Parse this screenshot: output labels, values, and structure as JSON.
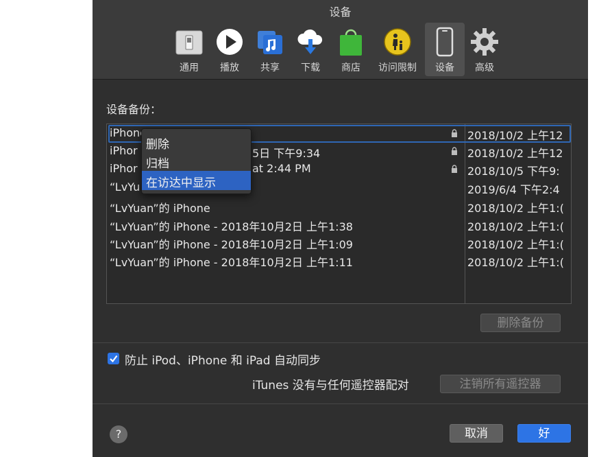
{
  "window": {
    "title": "设备"
  },
  "toolbar": {
    "items": [
      {
        "label": "通用",
        "icon": "general-switch-icon"
      },
      {
        "label": "播放",
        "icon": "play-icon"
      },
      {
        "label": "共享",
        "icon": "sharing-music-icon"
      },
      {
        "label": "下载",
        "icon": "cloud-download-icon"
      },
      {
        "label": "商店",
        "icon": "store-bag-icon"
      },
      {
        "label": "访问限制",
        "icon": "parental-controls-icon"
      },
      {
        "label": "设备",
        "icon": "device-iphone-icon"
      },
      {
        "label": "高级",
        "icon": "gear-icon"
      }
    ],
    "selected": "设备"
  },
  "backups": {
    "section_label": "设备备份：",
    "rows": [
      {
        "name": "iPhone",
        "locked": true,
        "date": "2018/10/2 上午12"
      },
      {
        "name": "iPhon…5日 下午9:34",
        "name_left": "iPhor",
        "name_right": "5日 下午9:34",
        "locked": true,
        "date": "2018/10/2 上午12"
      },
      {
        "name_left": "iPhor",
        "name_right": "at 2:44 PM",
        "locked": true,
        "date": "2018/10/5 下午9:"
      },
      {
        "name_left": "“LvYu",
        "locked": false,
        "date": "2019/6/4 下午2:4"
      },
      {
        "name": "“LvYuan”的 iPhone",
        "locked": false,
        "date": "2018/10/2 上午1:("
      },
      {
        "name": "“LvYuan”的 iPhone - 2018年10月2日 上午1:38",
        "locked": false,
        "date": "2018/10/2 上午1:("
      },
      {
        "name": "“LvYuan”的 iPhone - 2018年10月2日 上午1:09",
        "locked": false,
        "date": "2018/10/2 上午1:("
      },
      {
        "name": "“LvYuan”的 iPhone - 2018年10月2日 上午1:11",
        "locked": false,
        "date": "2018/10/2 上午1:("
      }
    ],
    "delete_button": "删除备份"
  },
  "context_menu": {
    "items": [
      {
        "label": "删除"
      },
      {
        "label": "归档"
      },
      {
        "label": "在访达中显示"
      }
    ],
    "highlighted": "在访达中显示"
  },
  "sync": {
    "prevent_label": "防止 iPod、iPhone 和 iPad 自动同步",
    "prevent_checked": true,
    "remote_status": "iTunes 没有与任何遥控器配对",
    "unpair_button": "注销所有遥控器"
  },
  "footer": {
    "help": "?",
    "cancel": "取消",
    "ok": "好"
  },
  "colors": {
    "accent": "#2d74e5",
    "window_bg": "#2f2f2f",
    "toolbar_bg": "#3b3b3b"
  }
}
